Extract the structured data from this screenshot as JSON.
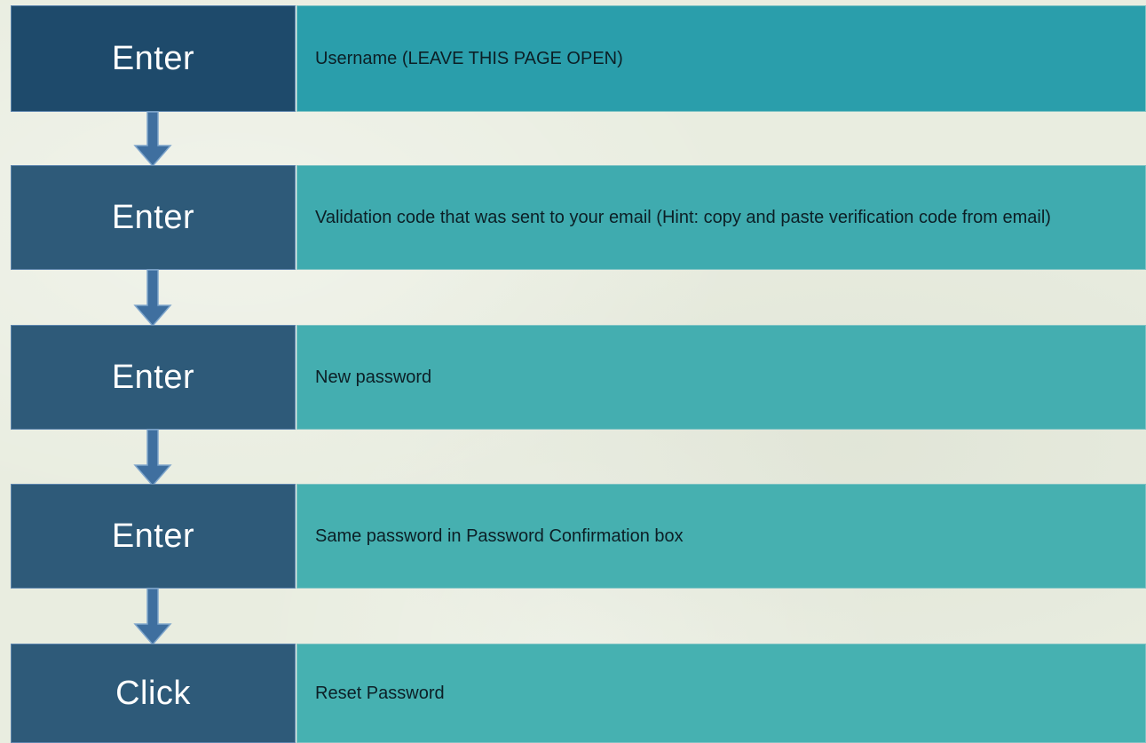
{
  "steps": [
    {
      "action": "Enter",
      "description": "Username (LEAVE THIS PAGE OPEN)"
    },
    {
      "action": "Enter",
      "description": "Validation code that was sent to your email (Hint: copy and paste verification code from email)"
    },
    {
      "action": "Enter",
      "description": "New password"
    },
    {
      "action": "Enter",
      "description": "Same password in Password Confirmation box"
    },
    {
      "action": "Click",
      "description": "Reset Password"
    }
  ],
  "colors": {
    "first_label": "#1e4a6b",
    "label": "#2e5a79",
    "desc_gradient": [
      "#2a9eab",
      "#3fabaf",
      "#44aeb0",
      "#46b0b0",
      "#46b1b1"
    ],
    "arrow": "#3f6f9f",
    "arrow_outline": "#7fa6cc",
    "background": "#e9ede0"
  }
}
